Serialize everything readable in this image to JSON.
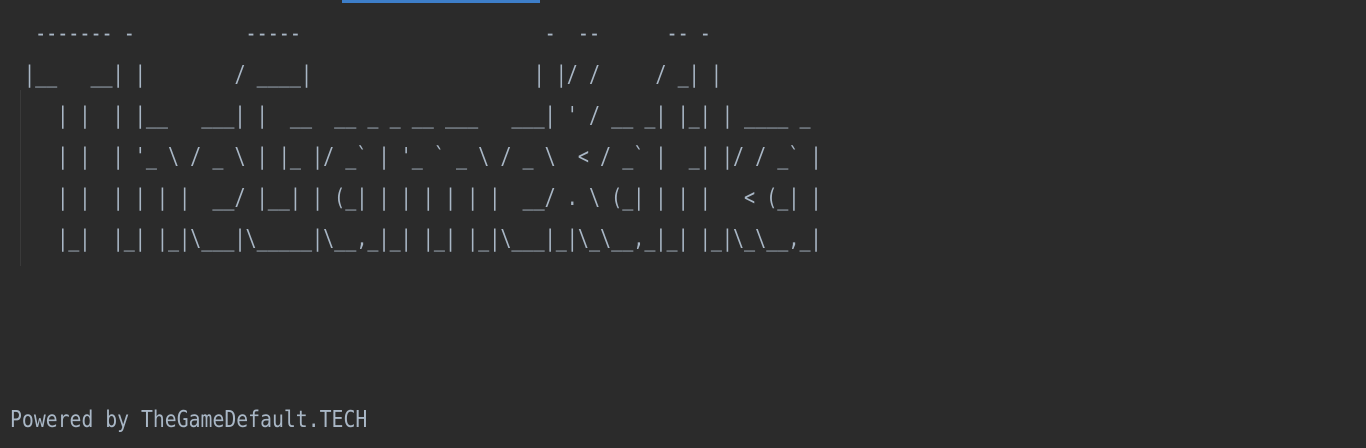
{
  "console": {
    "ascii_banner": " ------- -          -----                      -  --      -- -\n|__   __| |        / ____|                    | |/ /     / _| |\n   | |  | |__   ___| |  __  __ _ _ __ ___   ___| ' / __ _| |_| | ____ _\n   | |  | '_ \\ / _ \\ | |_ |/ _` | '_ ` _ \\ / _ \\  < / _` |  _| |/ / _` |\n   | |  | | | |  __/ |__| | (_| | | | | | |  __/ . \\ (_| | | |   < (_| |\n   |_|  |_| |_|\\___|\\_____|\\__,_|_| |_| |_|\\___|_|\\_\\__,_|_| |_|\\_\\__,_|",
    "powered_by": "Powered by TheGameDefault.TECH"
  },
  "colors": {
    "background": "#2b2b2b",
    "text": "#a9b7c6",
    "tab_indicator": "#3d7ec9"
  }
}
